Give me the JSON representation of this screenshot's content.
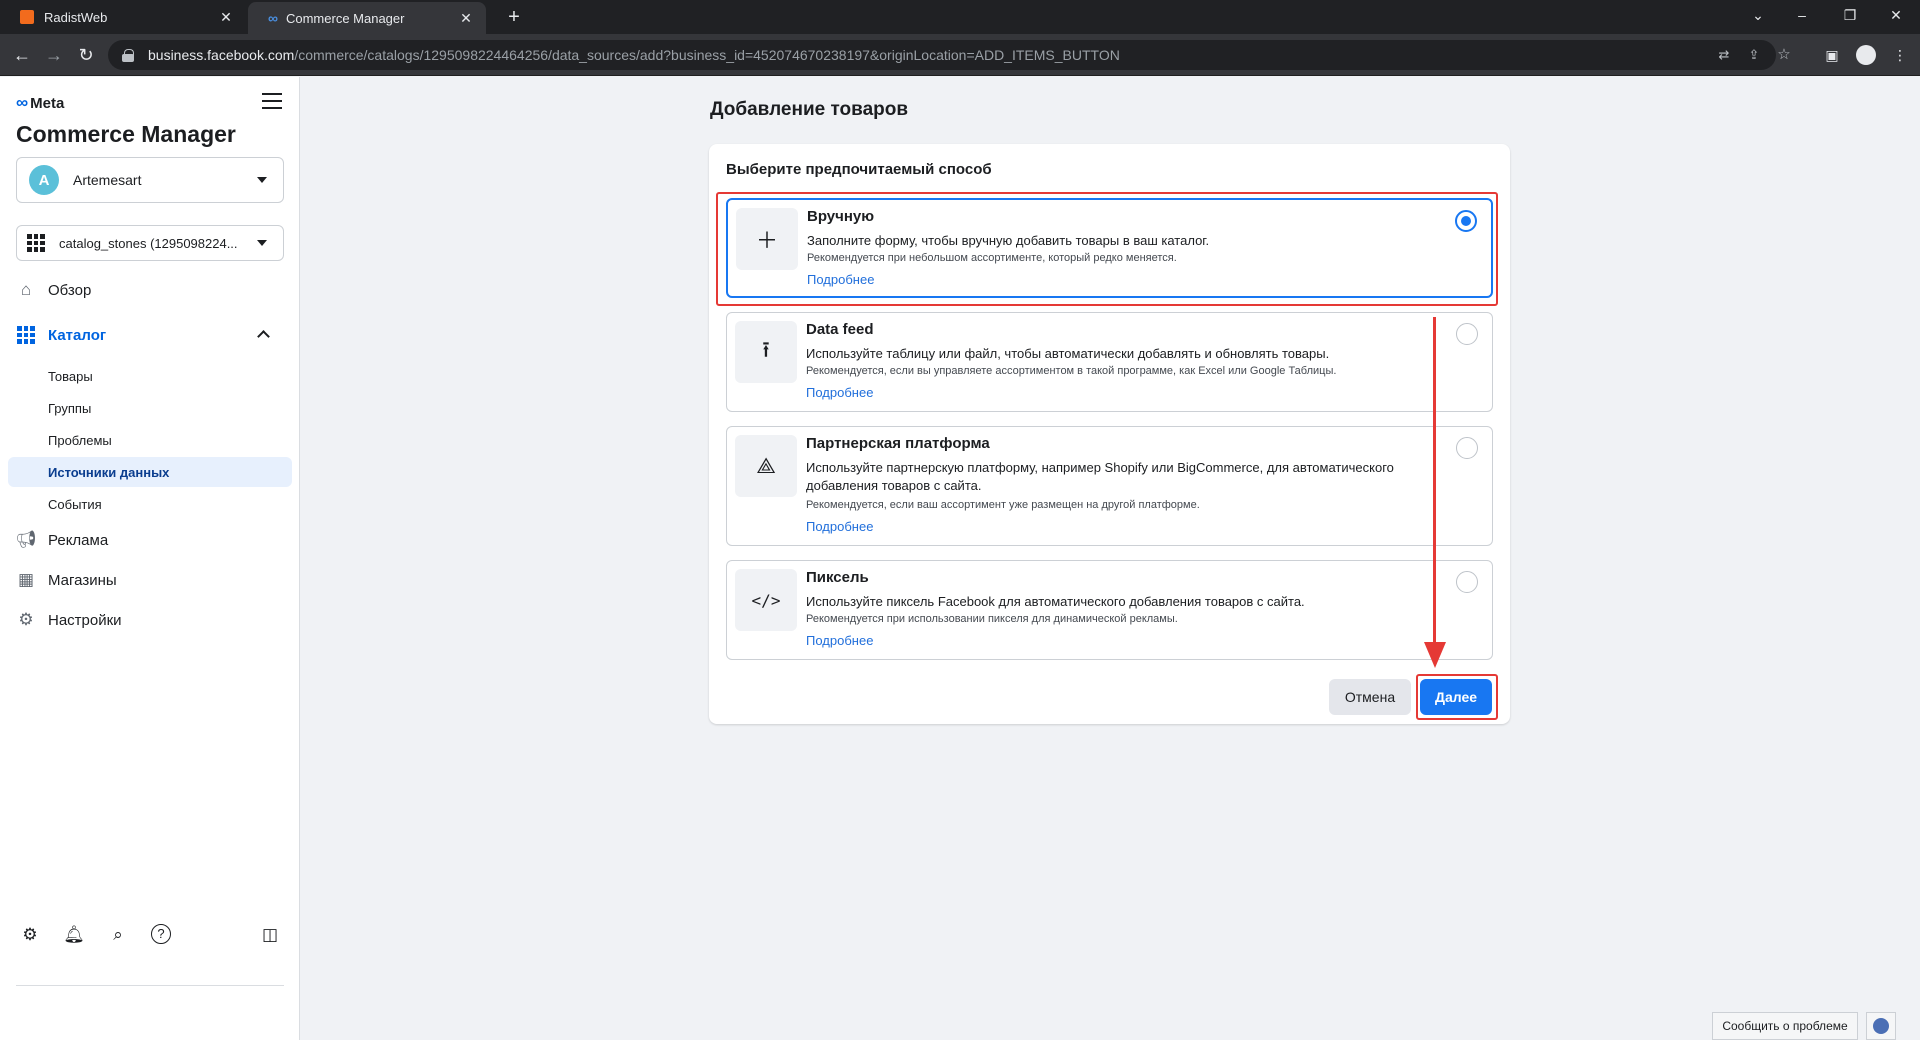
{
  "browser": {
    "tabs": [
      {
        "title": "RadistWeb"
      },
      {
        "title": "Commerce Manager"
      }
    ],
    "url_host": "business.facebook.com",
    "url_path": "/commerce/catalogs/1295098224464256/data_sources/add?business_id=452074670238197&originLocation=ADD_ITEMS_BUTTON"
  },
  "sidebar": {
    "brand": "Meta",
    "app_title": "Commerce Manager",
    "account": {
      "initial": "A",
      "name": "Artemesart"
    },
    "catalog": {
      "name": "catalog_stones (1295098224..."
    },
    "nav": [
      {
        "label": "Обзор",
        "icon": "home-icon"
      },
      {
        "label": "Каталог",
        "icon": "catalog-grid-icon"
      },
      {
        "label": "Реклама",
        "icon": "megaphone-icon"
      },
      {
        "label": "Магазины",
        "icon": "shop-icon"
      },
      {
        "label": "Настройки",
        "icon": "gear-icon"
      }
    ],
    "catalog_sub": [
      {
        "label": "Товары"
      },
      {
        "label": "Группы"
      },
      {
        "label": "Проблемы"
      },
      {
        "label": "Источники данных"
      },
      {
        "label": "События"
      }
    ]
  },
  "main": {
    "page_title": "Добавление товаров",
    "card_heading": "Выберите предпочитаемый способ",
    "options": [
      {
        "title": "Вручную",
        "description": "Заполните форму, чтобы вручную добавить товары в ваш каталог.",
        "note": "Рекомендуется при небольшом ассортименте, который редко меняется.",
        "link": "Подробнее",
        "icon": "plus-icon",
        "selected": true
      },
      {
        "title": "Data feed",
        "description": "Используйте таблицу или файл, чтобы автоматически добавлять и обновлять товары.",
        "note": "Рекомендуется, если вы управляете ассортиментом в такой программе, как Excel или Google Таблицы.",
        "link": "Подробнее",
        "icon": "upload-icon",
        "selected": false
      },
      {
        "title": "Партнерская платформа",
        "description": "Используйте партнерскую платформу, например Shopify или BigCommerce, для автоматического добавления товаров с сайта.",
        "note": "Рекомендуется, если ваш ассортимент уже размещен на другой платформе.",
        "link": "Подробнее",
        "icon": "partner-nodes-icon",
        "selected": false
      },
      {
        "title": "Пиксель",
        "description": "Используйте пиксель Facebook для автоматического добавления товаров с сайта.",
        "note": "Рекомендуется при использовании пикселя для динамической рекламы.",
        "link": "Подробнее",
        "icon": "code-icon",
        "selected": false
      }
    ],
    "cancel_label": "Отмена",
    "next_label": "Далее"
  },
  "footer": {
    "report_label": "Сообщить о проблеме"
  },
  "colors": {
    "accent": "#1877f2",
    "meta_blue": "#0064e0",
    "annotation_red": "#e53935"
  }
}
